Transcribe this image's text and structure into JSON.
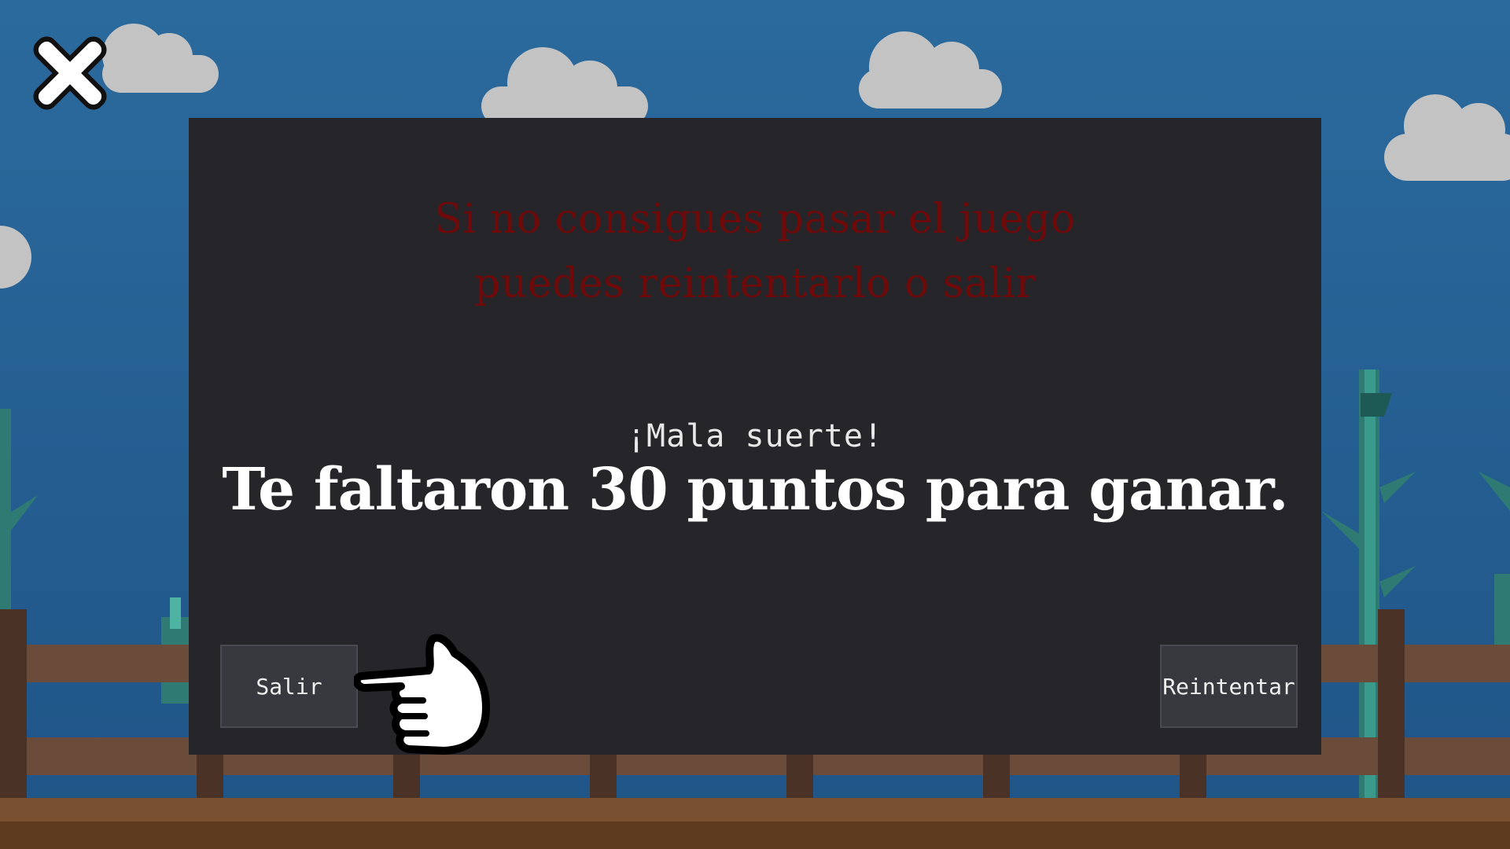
{
  "dialog": {
    "hint_line1": "Si no consigues pasar el juego",
    "hint_line2": "puedes reintentarlo o salir",
    "subtitle": "¡Mala suerte!",
    "result": "Te faltaron 30 puntos para ganar."
  },
  "buttons": {
    "exit_label": "Salir",
    "retry_label": "Reintentar"
  },
  "icons": {
    "close": "close-icon",
    "pointer": "pointing-hand-icon"
  },
  "colors": {
    "sky": "#2e6c9f",
    "dialog_bg": "#25252a",
    "hint_text": "#6e0a0a",
    "button_bg": "#38383f"
  }
}
